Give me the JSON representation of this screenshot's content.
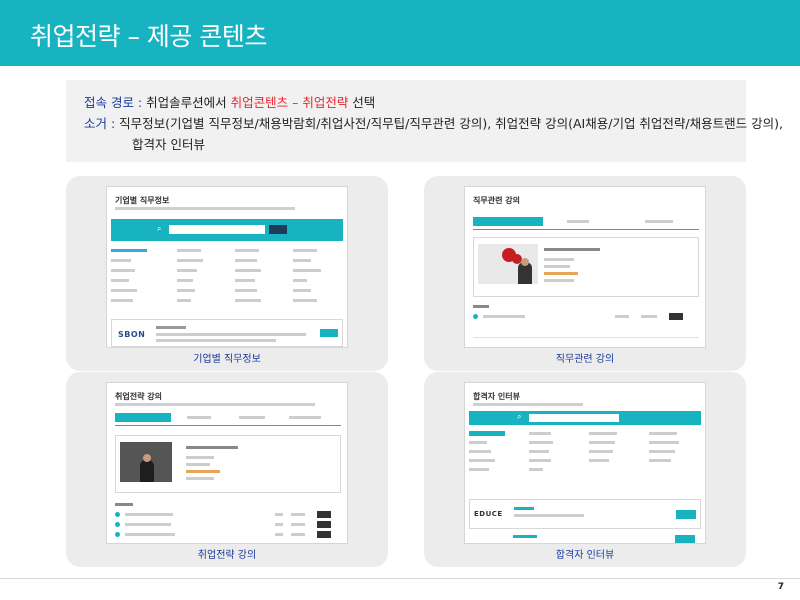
{
  "title": "취업전략 – 제공 콘텐츠",
  "info": {
    "path_label": "접속 경로 :",
    "path_before": " 취업솔루션에서 ",
    "path_highlight": "취업콘텐츠 – 취업전략",
    "path_after": " 선택",
    "desc_label": "소거 :",
    "desc_text": " 직무정보(기업별 직무정보/채용박람회/취업사전/직무팁/직무관련 강의), 취업전략 강의(AI채용/기업 취업전략/채용트랜드 강의),",
    "desc_text2": "합격자 인터뷰"
  },
  "cards": [
    {
      "caption": "기업별 직무정보",
      "mini_title": "기업별 직무정보",
      "logo_text": "SBON"
    },
    {
      "caption": "직무관련 강의",
      "mini_title": "직무관련 강의"
    },
    {
      "caption": "취업전략 강의",
      "mini_title": "취업전략 강의"
    },
    {
      "caption": "합격자 인터뷰",
      "mini_title": "합격자 인터뷰",
      "logo_text": "EDUCE"
    }
  ],
  "page_number": "7",
  "colors": {
    "accent": "#17b3c1",
    "label": "#1a3a9c",
    "highlight": "#e8262e"
  }
}
